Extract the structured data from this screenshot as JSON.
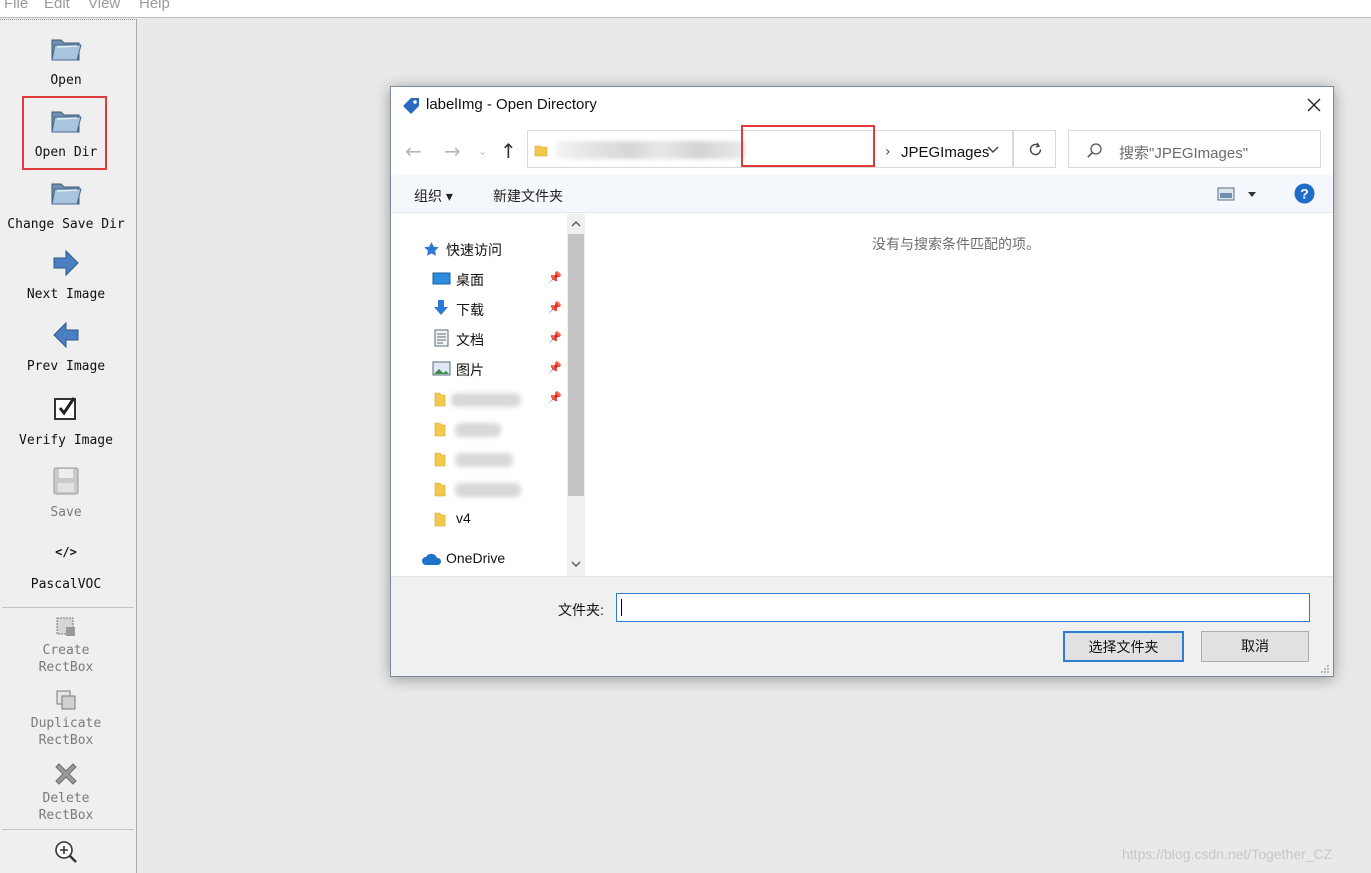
{
  "menubar": {
    "items": [
      "File",
      "Edit",
      "View",
      "Help"
    ]
  },
  "toolbar": {
    "open": "Open",
    "open_dir": "Open Dir",
    "change_save_dir": "Change Save Dir",
    "next_image": "Next Image",
    "prev_image": "Prev Image",
    "verify_image": "Verify Image",
    "save": "Save",
    "format_icon_text": "</>",
    "format": "PascalVOC",
    "create_rectbox_1": "Create",
    "create_rectbox_2": "RectBox",
    "duplicate_rectbox_1": "Duplicate",
    "duplicate_rectbox_2": "RectBox",
    "delete_rectbox_1": "Delete",
    "delete_rectbox_2": "RectBox"
  },
  "dialog": {
    "title": "labelImg - Open Directory",
    "address": {
      "current_folder": "JPEGImages"
    },
    "search": {
      "placeholder": "搜索\"JPEGImages\""
    },
    "commands": {
      "organize": "组织 ▾",
      "new_folder": "新建文件夹"
    },
    "nav_pane": {
      "quick_access": "快速访问",
      "items": [
        {
          "label": "桌面",
          "icon": "desktop-icon",
          "pinned": true
        },
        {
          "label": "下载",
          "icon": "download-icon",
          "pinned": true
        },
        {
          "label": "文档",
          "icon": "document-icon",
          "pinned": true
        },
        {
          "label": "图片",
          "icon": "picture-icon",
          "pinned": true
        },
        {
          "label": "v4",
          "icon": "folder-icon",
          "pinned": false
        }
      ],
      "onedrive": "OneDrive"
    },
    "content": {
      "empty_message": "没有与搜索条件匹配的项。"
    },
    "footer": {
      "folder_label": "文件夹:",
      "folder_value": "",
      "select_button": "选择文件夹",
      "cancel_button": "取消"
    }
  },
  "watermark": "https://blog.csdn.net/Together_CZ",
  "colors": {
    "highlight_red": "#e03a3a",
    "accent_blue": "#2c7dd3"
  }
}
